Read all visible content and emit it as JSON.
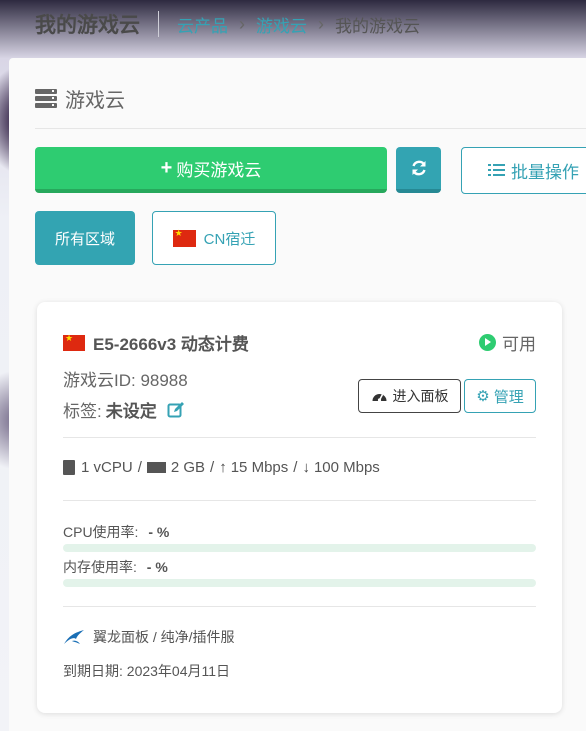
{
  "header": {
    "title": "我的游戏云",
    "breadcrumb": [
      "云产品",
      "游戏云",
      "我的游戏云"
    ]
  },
  "panel": {
    "title": "游戏云",
    "buy_label": "购买游戏云",
    "batch_label": "批量操作",
    "regions": [
      "所有区域",
      "CN宿迁"
    ],
    "active_region": "所有区域"
  },
  "server": {
    "name": "E5-2666v3 动态计费",
    "status": "可用",
    "id_text": "游戏云ID: 98988",
    "tag_label": "标签:",
    "tag_value": "未设定",
    "enter_panel_label": "进入面板",
    "manage_label": "管理",
    "cpu": "1 vCPU",
    "ram": "2 GB",
    "upload": "15 Mbps",
    "download": "100 Mbps",
    "spec_sep": "/",
    "cpu_usage_label": "CPU使用率:",
    "cpu_usage_value": "- %",
    "mem_usage_label": "内存使用率:",
    "mem_usage_value": "- %",
    "panel_info": "翼龙面板 / 纯净/插件服",
    "expiry_label": "到期日期:",
    "expiry_date": "2023年04月11日"
  },
  "colors": {
    "accent": "#33a4b2",
    "success": "#2ecc71"
  }
}
